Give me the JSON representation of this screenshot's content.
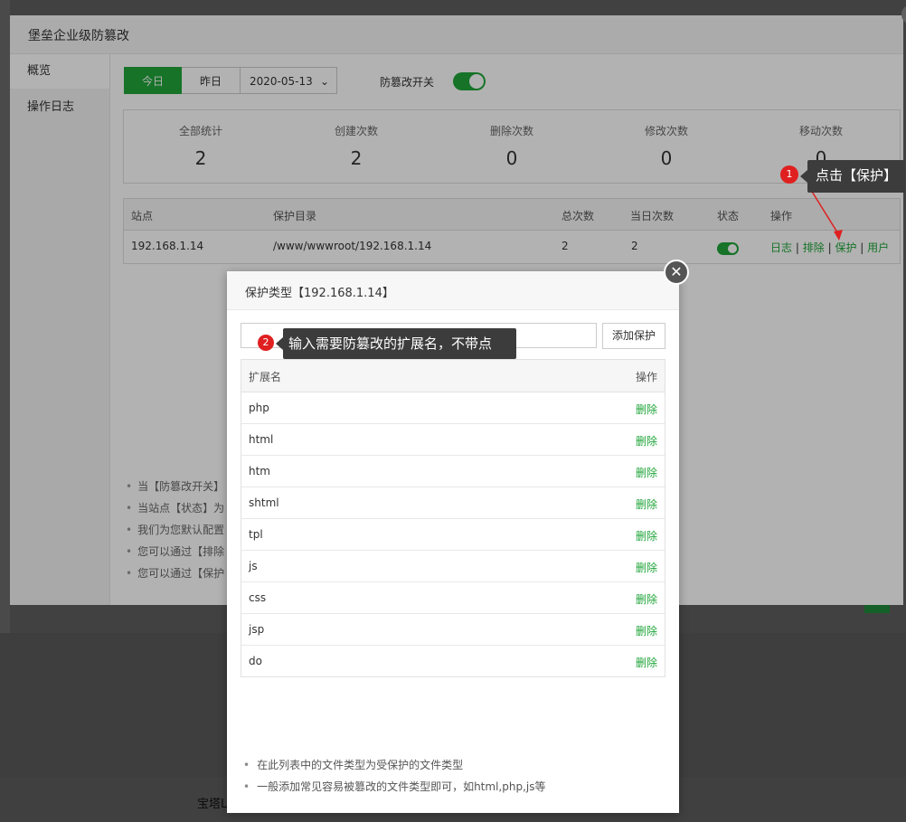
{
  "window": {
    "title": "堡垒企业级防篡改",
    "sidebar": [
      {
        "label": "概览"
      },
      {
        "label": "操作日志"
      }
    ]
  },
  "toolbar": {
    "today_label": "今日",
    "yesterday_label": "昨日",
    "date_value": "2020-05-13",
    "toggle_label": "防篡改开关",
    "toggle_on": true
  },
  "stats": [
    {
      "label": "全部统计",
      "value": "2"
    },
    {
      "label": "创建次数",
      "value": "2"
    },
    {
      "label": "删除次数",
      "value": "0"
    },
    {
      "label": "修改次数",
      "value": "0"
    },
    {
      "label": "移动次数",
      "value": "0"
    }
  ],
  "sites_table": {
    "headers": {
      "site": "站点",
      "dir": "保护目录",
      "total": "总次数",
      "today": "当日次数",
      "status": "状态",
      "ops": "操作"
    },
    "rows": [
      {
        "site": "192.168.1.14",
        "dir": "/www/wwwroot/192.168.1.14",
        "total": "2",
        "today": "2",
        "status_on": true,
        "ops": {
          "log": "日志",
          "exclude": "排除",
          "protect": "保护",
          "user": "用户"
        }
      }
    ]
  },
  "main_tips": [
    "当【防篡改开关】",
    "当站点【状态】为",
    "我们为您默认配置",
    "您可以通过【排除",
    "您可以通过【保护"
  ],
  "modal": {
    "title": "保护类型【192.168.1.14】",
    "input_placeholder": "",
    "add_button": "添加保护",
    "table_headers": {
      "ext": "扩展名",
      "op": "操作"
    },
    "extensions": [
      {
        "name": "php",
        "action": "删除"
      },
      {
        "name": "html",
        "action": "删除"
      },
      {
        "name": "htm",
        "action": "删除"
      },
      {
        "name": "shtml",
        "action": "删除"
      },
      {
        "name": "tpl",
        "action": "删除"
      },
      {
        "name": "js",
        "action": "删除"
      },
      {
        "name": "css",
        "action": "删除"
      },
      {
        "name": "jsp",
        "action": "删除"
      },
      {
        "name": "do",
        "action": "删除"
      }
    ],
    "tips": [
      "在此列表中的文件类型为受保护的文件类型",
      "一般添加常见容易被篡改的文件类型即可，如html,php,js等"
    ],
    "close_icon": "close-icon"
  },
  "annotations": {
    "step1_badge": "1",
    "step1_text": "点击【保护】",
    "step2_badge": "2",
    "step2_text": "输入需要防篡改的扩展名，不带点"
  },
  "footer_text": "宝塔Li",
  "colors": {
    "accent": "#20a53a",
    "badge": "#e02020",
    "callout": "#3c3c3c"
  }
}
